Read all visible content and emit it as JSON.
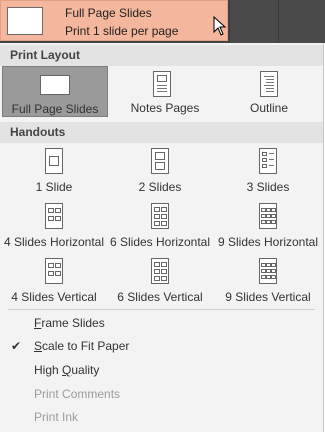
{
  "selected": {
    "title": "Full Page Slides",
    "subtitle": "Print 1 slide per page"
  },
  "print_layout": {
    "header": "Print Layout",
    "options": [
      {
        "label": "Full Page Slides",
        "icon": "full-page-slide-icon",
        "selected": true
      },
      {
        "label": "Notes Pages",
        "icon": "notes-pages-icon",
        "selected": false
      },
      {
        "label": "Outline",
        "icon": "outline-icon",
        "selected": false
      }
    ]
  },
  "handouts": {
    "header": "Handouts",
    "options": [
      {
        "label": "1 Slide",
        "icon": "handout-1-slide-icon"
      },
      {
        "label": "2 Slides",
        "icon": "handout-2-slides-icon"
      },
      {
        "label": "3 Slides",
        "icon": "handout-3-slides-icon"
      },
      {
        "label": "4 Slides Horizontal",
        "icon": "handout-4-horizontal-icon"
      },
      {
        "label": "6 Slides Horizontal",
        "icon": "handout-6-horizontal-icon"
      },
      {
        "label": "9 Slides Horizontal",
        "icon": "handout-9-horizontal-icon"
      },
      {
        "label": "4 Slides Vertical",
        "icon": "handout-4-vertical-icon"
      },
      {
        "label": "6 Slides Vertical",
        "icon": "handout-6-vertical-icon"
      },
      {
        "label": "9 Slides Vertical",
        "icon": "handout-9-vertical-icon"
      }
    ]
  },
  "options_menu": [
    {
      "pre": "",
      "ul": "F",
      "post": "rame Slides",
      "checked": false,
      "disabled": false
    },
    {
      "pre": "",
      "ul": "S",
      "post": "cale to Fit Paper",
      "checked": true,
      "disabled": false
    },
    {
      "pre": "High ",
      "ul": "Q",
      "post": "uality",
      "checked": false,
      "disabled": false
    },
    {
      "pre": "Print ",
      "ul": "C",
      "post": "omments",
      "checked": false,
      "disabled": true
    },
    {
      "pre": "Print ",
      "ul": "I",
      "post": "nk",
      "checked": false,
      "disabled": true
    }
  ],
  "check_glyph": "✔",
  "colors": {
    "selected_bg": "#f4b69c",
    "header_bg": "#e3e3e3",
    "panel_bg": "#f3f3f3",
    "active_tile_bg": "#9a9a9a",
    "disabled_text": "#9c9c9c"
  }
}
